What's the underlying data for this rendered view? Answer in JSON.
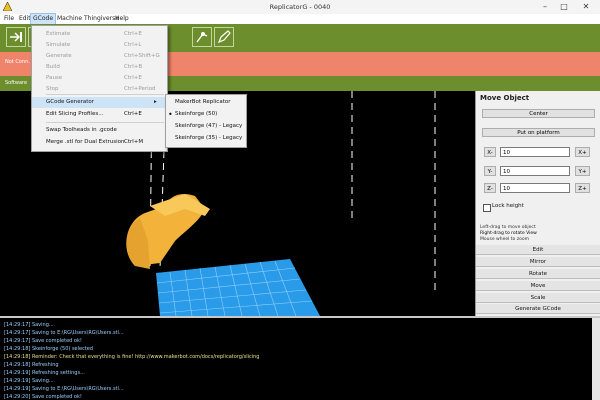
{
  "window": {
    "title": "ReplicatorG - 0040",
    "min": "–",
    "max": "□",
    "close": "✕"
  },
  "menu": [
    "File",
    "Edit",
    "GCode",
    "Machine",
    "Thingiverse",
    "Help"
  ],
  "status": {
    "left_text": "Not Conn.",
    "sub_text": "Software"
  },
  "dropdown": {
    "items": [
      {
        "label": "Estimate",
        "shortcut": "Ctrl+E",
        "enabled": false
      },
      {
        "label": "Simulate",
        "shortcut": "Ctrl+L",
        "enabled": false
      },
      {
        "label": "Generate",
        "shortcut": "Ctrl+Shift+G",
        "enabled": false
      },
      {
        "label": "Build",
        "shortcut": "Ctrl+B",
        "enabled": false
      },
      {
        "label": "Pause",
        "shortcut": "Ctrl+E",
        "enabled": false
      },
      {
        "label": "Stop",
        "shortcut": "Ctrl+Period",
        "enabled": false
      },
      {
        "label": "GCode Generator",
        "shortcut": "",
        "enabled": true,
        "submenu": true
      },
      {
        "label": "Edit Slicing Profiles...",
        "shortcut": "Ctrl+E",
        "enabled": true
      },
      {
        "label": "Swap Toolheads in .gcode",
        "shortcut": "",
        "enabled": true
      },
      {
        "label": "Merge .stl for Dual Extrusion",
        "shortcut": "Ctrl+M",
        "enabled": true
      }
    ]
  },
  "submenu": {
    "items": [
      {
        "label": "MakerBot Replicator",
        "checked": false
      },
      {
        "label": "Skeinforge (50)",
        "checked": true
      },
      {
        "label": "Skeinforge (47) - Legacy",
        "checked": false
      },
      {
        "label": "Skeinforge (35) - Legacy",
        "checked": false
      }
    ]
  },
  "panel": {
    "title": "Move Object",
    "center": "Center",
    "put_on_platform": "Put on platform",
    "x_minus": "X-",
    "x_val": "10",
    "x_plus": "X+",
    "y_minus": "Y-",
    "y_val": "10",
    "y_plus": "Y+",
    "z_minus": "Z-",
    "z_val": "10",
    "z_plus": "Z+",
    "lock_label": "Lock height",
    "hint1": "Left-drag to move object",
    "hint2": "Right-drag to rotate View",
    "hint3": "Mouse wheel to zoom",
    "tabs": [
      "Edit",
      "Mirror",
      "Rotate",
      "Move",
      "Scale",
      "Generate GCode"
    ]
  },
  "console": {
    "lines": [
      {
        "t": "[14:29:17] Saving...",
        "c": "#9bd0ff"
      },
      {
        "t": "[14:29:17] Saving to E:\\RG\\Users\\RG\\Users.stl...",
        "c": "#9bd0ff"
      },
      {
        "t": "[14:29:17] Save completed ok!",
        "c": "#9bd0ff"
      },
      {
        "t": "[14:29:18] Skeinforge (50) selected",
        "c": "#9bd0ff"
      },
      {
        "t": "[14:29:18] Reminder: Check that everything is fine! http://www.makerbot.com/docs/replicatorg/slicing",
        "c": "#e6e28a"
      },
      {
        "t": "[14:29:18] Refreshing",
        "c": "#9bd0ff"
      },
      {
        "t": "[14:29:19] Refreshing settings...",
        "c": "#9bd0ff"
      },
      {
        "t": "[14:29:19] Saving...",
        "c": "#9bd0ff"
      },
      {
        "t": "[14:29:19] Saving to E:\\RG\\Users\\RG\\Users.stl...",
        "c": "#9bd0ff"
      },
      {
        "t": "[14:29:20] Save completed ok!",
        "c": "#9bd0ff"
      }
    ]
  },
  "colors": {
    "toolbar": "#6d8e2c",
    "status": "#f0846a",
    "object": "#f3b23a",
    "platform": "#2a9be8"
  }
}
